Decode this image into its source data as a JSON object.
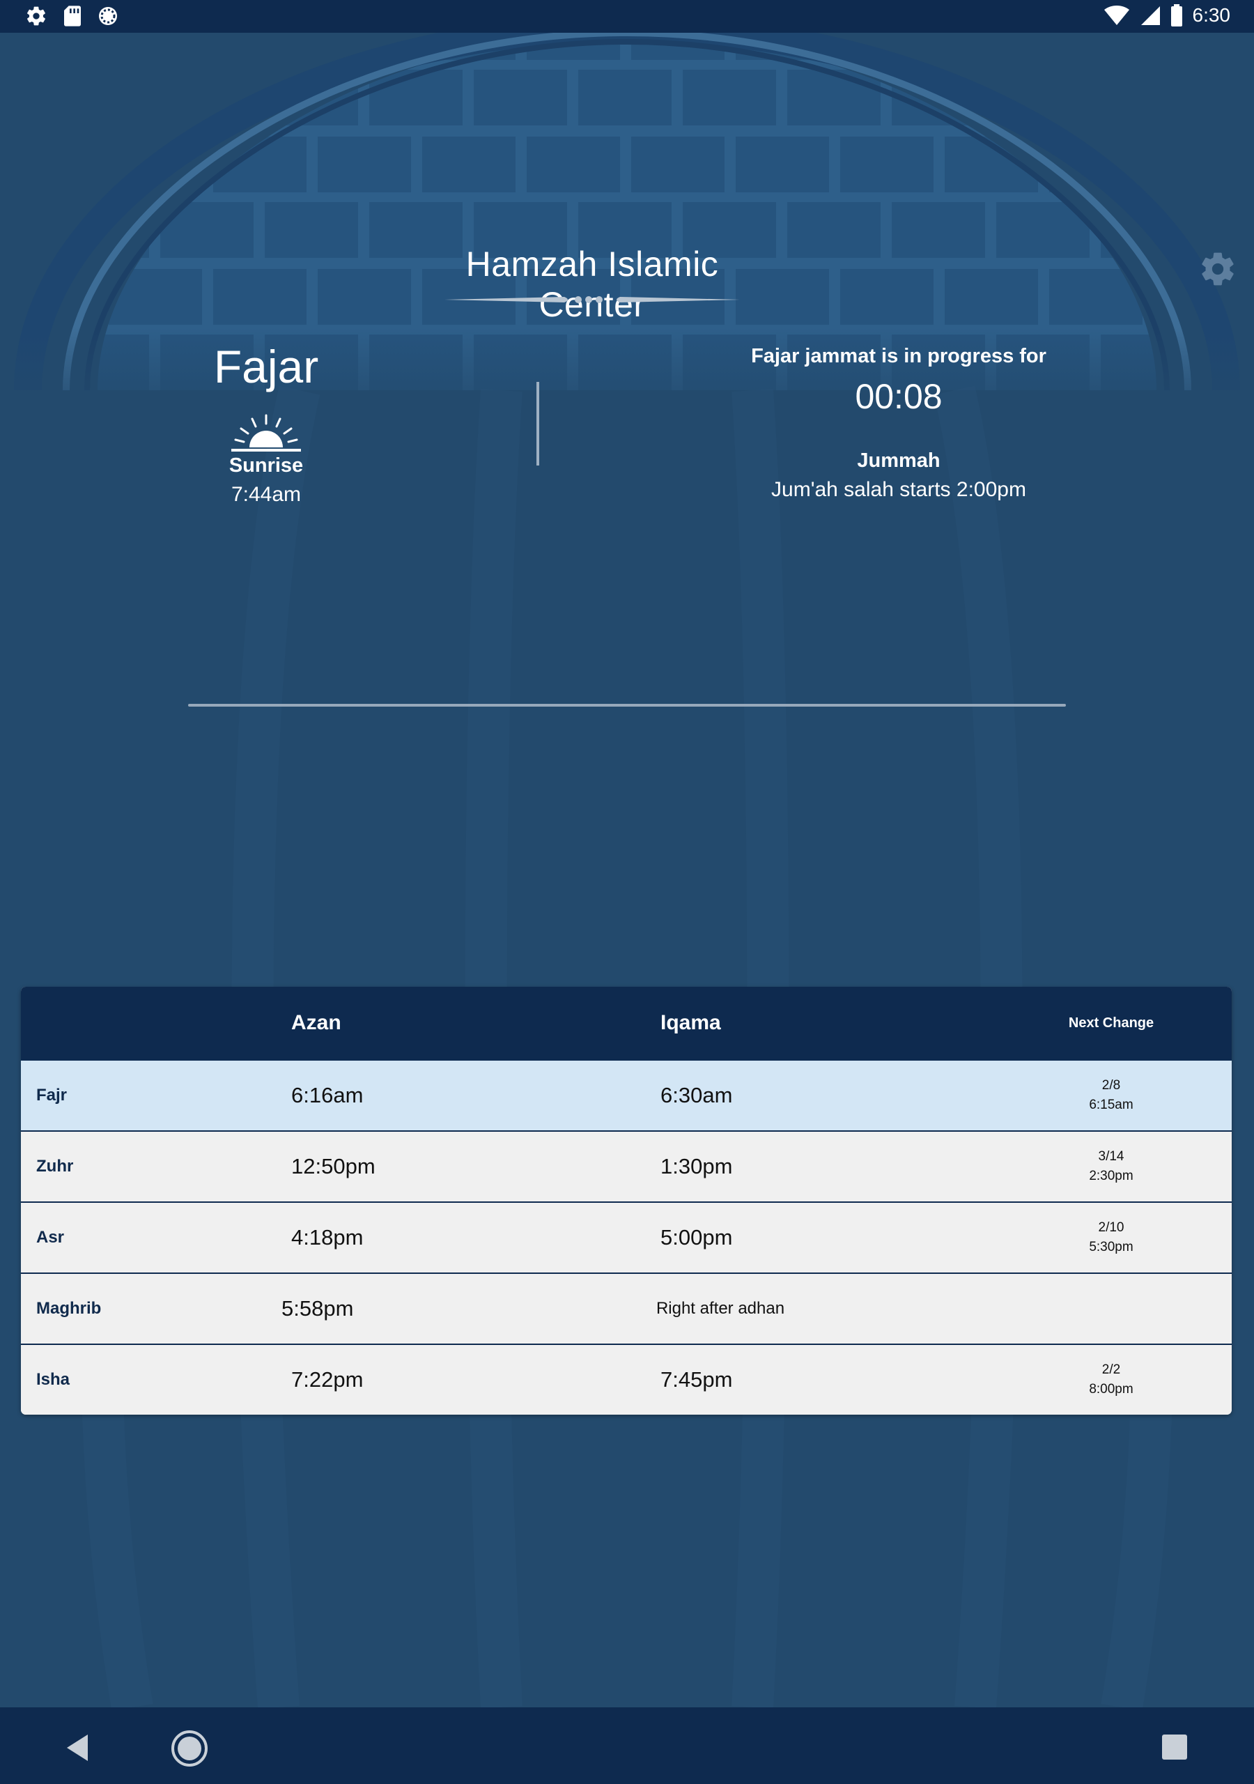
{
  "status_bar": {
    "time": "6:30"
  },
  "header": {
    "title": "Hamzah Islamic Center"
  },
  "current": {
    "prayer": "Fajar",
    "sunrise_label": "Sunrise",
    "sunrise_time": "7:44am",
    "progress_label": "Fajar jammat is in progress for",
    "countdown": "00:08",
    "jummah_title": "Jummah",
    "jummah_text": "Jum'ah salah starts 2:00pm"
  },
  "table": {
    "headers": {
      "name": "",
      "azan": "Azan",
      "iqama": "Iqama",
      "next_change": "Next Change"
    },
    "rows": [
      {
        "name": "Fajr",
        "azan": "6:16am",
        "iqama": "6:30am",
        "next_date": "2/8",
        "next_time": "6:15am"
      },
      {
        "name": "Zuhr",
        "azan": "12:50pm",
        "iqama": "1:30pm",
        "next_date": "3/14",
        "next_time": "2:30pm"
      },
      {
        "name": "Asr",
        "azan": "4:18pm",
        "iqama": "5:00pm",
        "next_date": "2/10",
        "next_time": "5:30pm"
      },
      {
        "name": "Maghrib",
        "azan": "5:58pm",
        "iqama": "Right after adhan",
        "next_date": "",
        "next_time": ""
      },
      {
        "name": "Isha",
        "azan": "7:22pm",
        "iqama": "7:45pm",
        "next_date": "2/2",
        "next_time": "8:00pm"
      }
    ]
  },
  "colors": {
    "background": "#234a6d",
    "bar": "#0e2a4f",
    "table_header": "#0e2a4f",
    "active_row": "#d3e6f5",
    "row": "#f0f0f0"
  },
  "icons": [
    "settings-icon",
    "sd-card-icon",
    "sync-icon",
    "wifi-icon",
    "signal-icon",
    "battery-icon",
    "gear-icon",
    "sunrise-icon",
    "back-icon",
    "home-icon",
    "recent-apps-icon"
  ]
}
